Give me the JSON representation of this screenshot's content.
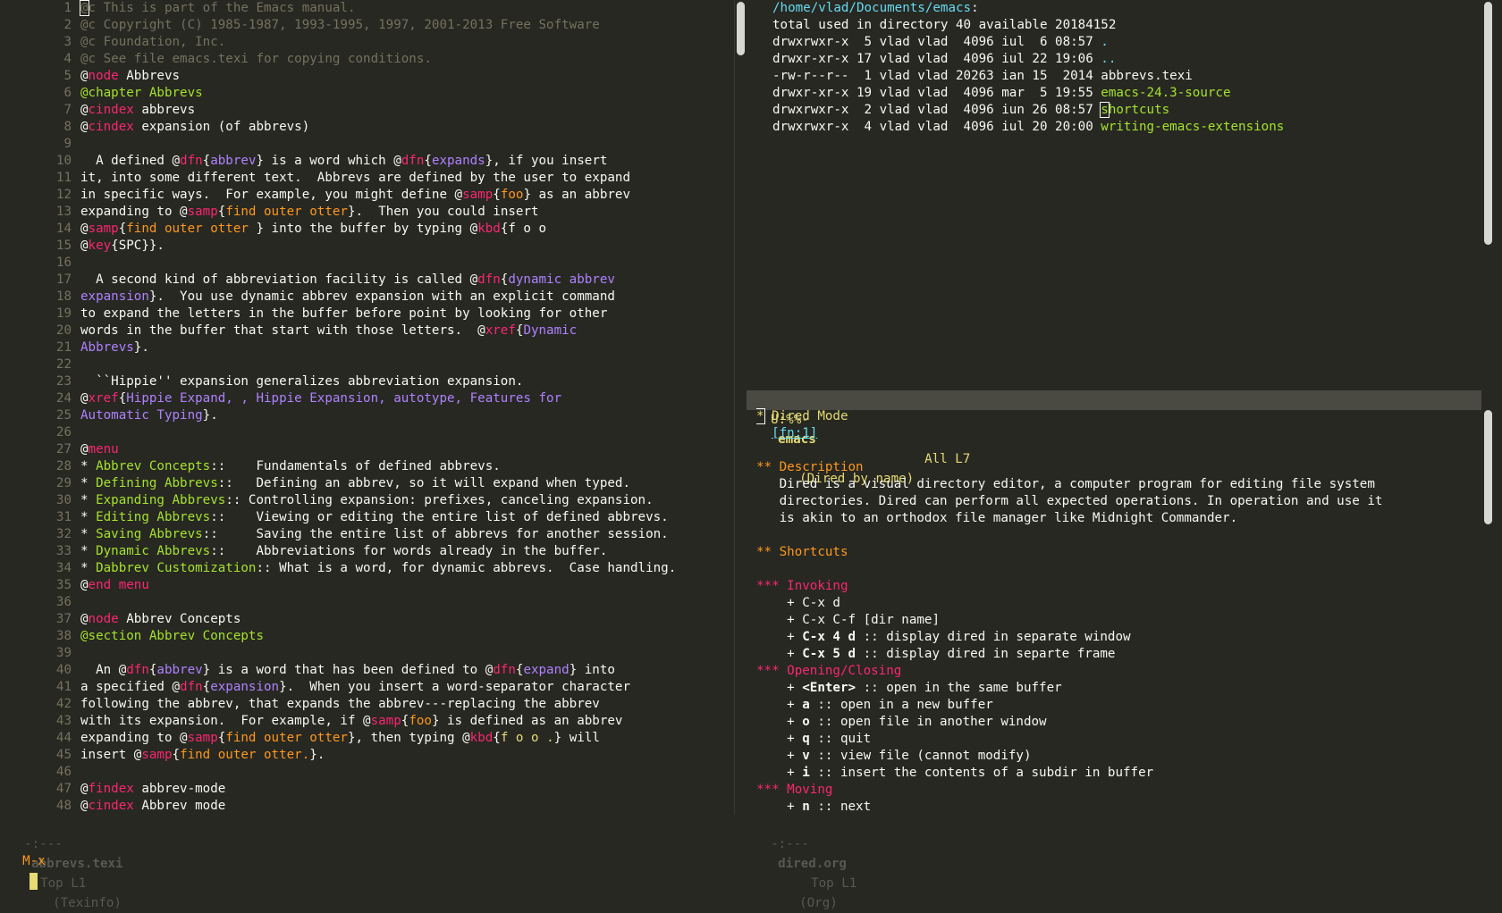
{
  "colors": {
    "background": "#272822",
    "foreground": "#f8f8f2",
    "comment": "#75715e",
    "pink": "#f92672",
    "green": "#a6e22e",
    "purple": "#ae81ff",
    "orange": "#fd971f",
    "yellow": "#e6db74",
    "blue": "#66d9ef"
  },
  "left_buffer": {
    "line_numbers": [
      "1",
      "2",
      "3",
      "4",
      "5",
      "6",
      "7",
      "8",
      "9",
      "10",
      "11",
      "12",
      "13",
      "14",
      "15",
      "16",
      "17",
      "18",
      "19",
      "20",
      "21",
      "22",
      "23",
      "24",
      "25",
      "26",
      "27",
      "28",
      "29",
      "30",
      "31",
      "32",
      "33",
      "34",
      "35",
      "36",
      "37",
      "38",
      "39",
      "40",
      "41",
      "42",
      "43",
      "44",
      "45",
      "46",
      "47",
      "48"
    ],
    "lines": [
      [
        {
          "t": "@",
          "c": "cm cursor-box"
        },
        {
          "t": "c This is part of the Emacs manual.",
          "c": "cm"
        }
      ],
      [
        {
          "t": "@c Copyright (C) 1985-1987, 1993-1995, 1997, 2001-2013 Free Software",
          "c": "cm"
        }
      ],
      [
        {
          "t": "@c Foundation, Inc.",
          "c": "cm"
        }
      ],
      [
        {
          "t": "@c See file emacs.texi for copying conditions.",
          "c": "cm"
        }
      ],
      [
        {
          "t": "@"
        },
        {
          "t": "node",
          "c": "kw-pink"
        },
        {
          "t": " Abbrevs"
        }
      ],
      [
        {
          "t": "@chapter Abbrevs",
          "c": "kw-green"
        }
      ],
      [
        {
          "t": "@"
        },
        {
          "t": "cindex",
          "c": "kw-pink"
        },
        {
          "t": " abbrevs"
        }
      ],
      [
        {
          "t": "@"
        },
        {
          "t": "cindex",
          "c": "kw-pink"
        },
        {
          "t": " expansion (of abbrevs)"
        }
      ],
      [],
      [
        {
          "t": "  A defined @"
        },
        {
          "t": "dfn",
          "c": "kw-pink"
        },
        {
          "t": "{"
        },
        {
          "t": "abbrev",
          "c": "kw-purple"
        },
        {
          "t": "} is a word which @"
        },
        {
          "t": "dfn",
          "c": "kw-pink"
        },
        {
          "t": "{"
        },
        {
          "t": "expands",
          "c": "kw-purple"
        },
        {
          "t": "}, if you insert"
        }
      ],
      [
        {
          "t": "it, into some different text.  Abbrevs are defined by the user to expand"
        }
      ],
      [
        {
          "t": "in specific ways.  For example, you might define @"
        },
        {
          "t": "samp",
          "c": "kw-pink"
        },
        {
          "t": "{"
        },
        {
          "t": "foo",
          "c": "kw-orange"
        },
        {
          "t": "} as an abbrev"
        }
      ],
      [
        {
          "t": "expanding to @"
        },
        {
          "t": "samp",
          "c": "kw-pink"
        },
        {
          "t": "{"
        },
        {
          "t": "find outer otter",
          "c": "kw-orange"
        },
        {
          "t": "}.  Then you could insert"
        }
      ],
      [
        {
          "t": "@"
        },
        {
          "t": "samp",
          "c": "kw-pink"
        },
        {
          "t": "{"
        },
        {
          "t": "find outer otter",
          "c": "kw-orange"
        },
        {
          "t": " } into the buffer by typing @"
        },
        {
          "t": "kbd",
          "c": "kw-pink"
        },
        {
          "t": "{f o o"
        }
      ],
      [
        {
          "t": "@"
        },
        {
          "t": "key",
          "c": "kw-pink"
        },
        {
          "t": "{SPC}}."
        }
      ],
      [],
      [
        {
          "t": "  A second kind of abbreviation facility is called @"
        },
        {
          "t": "dfn",
          "c": "kw-pink"
        },
        {
          "t": "{"
        },
        {
          "t": "dynamic abbrev",
          "c": "kw-purple"
        }
      ],
      [
        {
          "t": "expansion",
          "c": "kw-purple"
        },
        {
          "t": "}.  You use dynamic abbrev expansion with an explicit command"
        }
      ],
      [
        {
          "t": "to expand the letters in the buffer before point by looking for other"
        }
      ],
      [
        {
          "t": "words in the buffer that start with those letters.  @"
        },
        {
          "t": "xref",
          "c": "kw-pink"
        },
        {
          "t": "{"
        },
        {
          "t": "Dynamic",
          "c": "kw-purple"
        }
      ],
      [
        {
          "t": "Abbrevs",
          "c": "kw-purple"
        },
        {
          "t": "}."
        }
      ],
      [],
      [
        {
          "t": "  ``Hippie'' expansion generalizes abbreviation expansion."
        }
      ],
      [
        {
          "t": "@"
        },
        {
          "t": "xref",
          "c": "kw-pink"
        },
        {
          "t": "{"
        },
        {
          "t": "Hippie Expand, , Hippie Expansion, autotype, Features for",
          "c": "kw-purple"
        }
      ],
      [
        {
          "t": "Automatic Typing",
          "c": "kw-purple"
        },
        {
          "t": "}."
        }
      ],
      [],
      [
        {
          "t": "@"
        },
        {
          "t": "menu",
          "c": "kw-pink"
        }
      ],
      [
        {
          "t": "* "
        },
        {
          "t": "Abbrev Concepts",
          "c": "kw-green"
        },
        {
          "t": "::    Fundamentals of defined abbrevs."
        }
      ],
      [
        {
          "t": "* "
        },
        {
          "t": "Defining Abbrevs",
          "c": "kw-green"
        },
        {
          "t": "::   Defining an abbrev, so it will expand when typed."
        }
      ],
      [
        {
          "t": "* "
        },
        {
          "t": "Expanding Abbrevs",
          "c": "kw-green"
        },
        {
          "t": ":: Controlling expansion: prefixes, canceling expansion."
        }
      ],
      [
        {
          "t": "* "
        },
        {
          "t": "Editing Abbrevs",
          "c": "kw-green"
        },
        {
          "t": "::    Viewing or editing the entire list of defined abbrevs."
        }
      ],
      [
        {
          "t": "* "
        },
        {
          "t": "Saving Abbrevs",
          "c": "kw-green"
        },
        {
          "t": "::     Saving the entire list of abbrevs for another session."
        }
      ],
      [
        {
          "t": "* "
        },
        {
          "t": "Dynamic Abbrevs",
          "c": "kw-green"
        },
        {
          "t": "::    Abbreviations for words already in the buffer."
        }
      ],
      [
        {
          "t": "* "
        },
        {
          "t": "Dabbrev Customization",
          "c": "kw-green"
        },
        {
          "t": ":: What is a word, for dynamic abbrevs.  Case handling."
        }
      ],
      [
        {
          "t": "@"
        },
        {
          "t": "end menu",
          "c": "kw-pink"
        }
      ],
      [],
      [
        {
          "t": "@"
        },
        {
          "t": "node",
          "c": "kw-pink"
        },
        {
          "t": " Abbrev Concepts"
        }
      ],
      [
        {
          "t": "@section Abbrev Concepts",
          "c": "kw-green"
        }
      ],
      [],
      [
        {
          "t": "  An @"
        },
        {
          "t": "dfn",
          "c": "kw-pink"
        },
        {
          "t": "{"
        },
        {
          "t": "abbrev",
          "c": "kw-purple"
        },
        {
          "t": "} is a word that has been defined to @"
        },
        {
          "t": "dfn",
          "c": "kw-pink"
        },
        {
          "t": "{"
        },
        {
          "t": "expand",
          "c": "kw-purple"
        },
        {
          "t": "} into"
        }
      ],
      [
        {
          "t": "a specified @"
        },
        {
          "t": "dfn",
          "c": "kw-pink"
        },
        {
          "t": "{"
        },
        {
          "t": "expansion",
          "c": "kw-purple"
        },
        {
          "t": "}.  When you insert a word-separator character"
        }
      ],
      [
        {
          "t": "following the abbrev, that expands the abbrev---replacing the abbrev"
        }
      ],
      [
        {
          "t": "with its expansion.  For example, if @"
        },
        {
          "t": "samp",
          "c": "kw-pink"
        },
        {
          "t": "{"
        },
        {
          "t": "foo",
          "c": "kw-orange"
        },
        {
          "t": "} is defined as an abbrev"
        }
      ],
      [
        {
          "t": "expanding to @"
        },
        {
          "t": "samp",
          "c": "kw-pink"
        },
        {
          "t": "{"
        },
        {
          "t": "find outer otter",
          "c": "kw-orange"
        },
        {
          "t": "}, then typing @"
        },
        {
          "t": "kbd",
          "c": "kw-pink"
        },
        {
          "t": "{"
        },
        {
          "t": "f o o .",
          "c": "kw-yellow"
        },
        {
          "t": "} will"
        }
      ],
      [
        {
          "t": "insert @"
        },
        {
          "t": "samp",
          "c": "kw-pink"
        },
        {
          "t": "{"
        },
        {
          "t": "find outer otter.",
          "c": "kw-orange"
        },
        {
          "t": "}."
        }
      ],
      [],
      [
        {
          "t": "@"
        },
        {
          "t": "findex",
          "c": "kw-pink"
        },
        {
          "t": " abbrev-mode"
        }
      ],
      [
        {
          "t": "@"
        },
        {
          "t": "cindex",
          "c": "kw-pink"
        },
        {
          "t": " Abbrev mode"
        }
      ]
    ],
    "modeline": {
      "flags": "-:---",
      "buffer_name": "abbrevs.texi",
      "position": "Top L1",
      "mode": "(Texinfo)"
    }
  },
  "dired_buffer": {
    "lines": [
      [
        {
          "t": "/home/vlad/Documents/emacs",
          "c": "dir-blue"
        },
        {
          "t": ":"
        }
      ],
      [
        {
          "t": "total used in directory 40 available 20184152"
        }
      ],
      [
        {
          "t": "drwxrwxr-x  5 vlad vlad  4096 iul  6 08:57 "
        },
        {
          "t": ".",
          "c": "dir-blue"
        }
      ],
      [
        {
          "t": "drwxr-xr-x 17 vlad vlad  4096 iul 22 19:06 "
        },
        {
          "t": "..",
          "c": "dir-blue"
        }
      ],
      [
        {
          "t": "-rw-r--r--  1 vlad vlad 20263 ian 15  2014 abbrevs.texi"
        }
      ],
      [
        {
          "t": "drwxr-xr-x 19 vlad vlad  4096 mar  5 19:55 "
        },
        {
          "t": "emacs-24.3-source",
          "c": "kw-green"
        }
      ],
      [
        {
          "t": "drwxrwxr-x  2 vlad vlad  4096 iun 26 08:57 "
        },
        {
          "t": "s",
          "c": "kw-green cursor-box"
        },
        {
          "t": "hortcuts",
          "c": "kw-green"
        }
      ],
      [
        {
          "t": "drwxrwxr-x  4 vlad vlad  4096 iul 20 20:00 "
        },
        {
          "t": "writing-emacs-extensions",
          "c": "kw-green"
        }
      ]
    ],
    "modeline": {
      "flags": "U:%%-",
      "buffer_name": "emacs",
      "position": "All L7",
      "mode": "(Dired by name)"
    }
  },
  "org_buffer": {
    "lines": [
      [
        {
          "t": "*",
          "c": "kw-yellow cursor-box"
        },
        {
          "t": " Dired Mode",
          "c": "kw-yellow"
        }
      ],
      [
        {
          "t": "  "
        },
        {
          "t": "[fn:1]",
          "c": "link"
        }
      ],
      [],
      [
        {
          "t": "** Description",
          "c": "h2"
        }
      ],
      [
        {
          "t": "   Dired is a visual directory editor, a computer program for editing file system"
        }
      ],
      [
        {
          "t": "   directories. Dired can perform all expected operations. In operation and use it"
        }
      ],
      [
        {
          "t": "   is akin to an orthodox file manager like Midnight Commander."
        }
      ],
      [],
      [
        {
          "t": "** Shortcuts",
          "c": "h2"
        }
      ],
      [],
      [
        {
          "t": "*** Invoking",
          "c": "h3"
        }
      ],
      [
        {
          "t": "    + C-x d"
        }
      ],
      [
        {
          "t": "    + C-x C-f [dir name]"
        }
      ],
      [
        {
          "t": "    + "
        },
        {
          "t": "C-x 4 d",
          "c": "bold"
        },
        {
          "t": " :: display dired in separate window"
        }
      ],
      [
        {
          "t": "    + "
        },
        {
          "t": "C-x 5 d",
          "c": "bold"
        },
        {
          "t": " :: display dired in separte frame"
        }
      ],
      [
        {
          "t": "*** Opening/Closing",
          "c": "h3"
        }
      ],
      [
        {
          "t": "    + "
        },
        {
          "t": "<Enter>",
          "c": "bold"
        },
        {
          "t": " :: open in the same buffer"
        }
      ],
      [
        {
          "t": "    + "
        },
        {
          "t": "a",
          "c": "bold"
        },
        {
          "t": " :: open in a new buffer"
        }
      ],
      [
        {
          "t": "    + "
        },
        {
          "t": "o",
          "c": "bold"
        },
        {
          "t": " :: open file in another window"
        }
      ],
      [
        {
          "t": "    + "
        },
        {
          "t": "q",
          "c": "bold"
        },
        {
          "t": " :: quit"
        }
      ],
      [
        {
          "t": "    + "
        },
        {
          "t": "v",
          "c": "bold"
        },
        {
          "t": " :: view file (cannot modify)"
        }
      ],
      [
        {
          "t": "    + "
        },
        {
          "t": "i",
          "c": "bold"
        },
        {
          "t": " :: insert the contents of a subdir in buffer"
        }
      ],
      [
        {
          "t": "*** Moving",
          "c": "h3"
        }
      ],
      [
        {
          "t": "    + "
        },
        {
          "t": "n",
          "c": "bold"
        },
        {
          "t": " :: next"
        }
      ]
    ],
    "modeline": {
      "flags": "-:---",
      "buffer_name": "dired.org",
      "position": "Top L1",
      "mode": "(Org)"
    }
  },
  "minibuffer": {
    "prompt": "M-x"
  }
}
